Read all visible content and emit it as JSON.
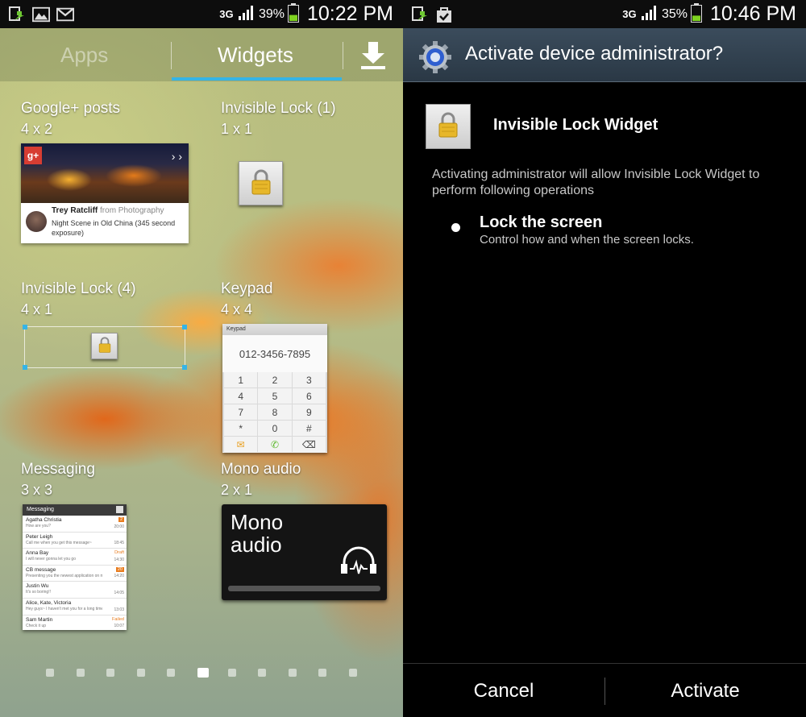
{
  "left": {
    "status": {
      "network": "3G",
      "battery_pct": "39%",
      "battery_level": 0.39,
      "time": "10:22 PM",
      "icons": [
        "screen-mirror-icon",
        "gallery-icon",
        "gmail-icon"
      ]
    },
    "tabs": {
      "apps": "Apps",
      "widgets": "Widgets",
      "download_icon": "download-icon"
    },
    "widgets": {
      "gplus": {
        "title": "Google+ posts",
        "size": "4 x 2",
        "logo": "g+",
        "nav": "› ›",
        "author": "Trey Ratcliff",
        "from": "from Photography",
        "caption": "Night Scene in Old China  (345 second exposure)"
      },
      "lock1": {
        "title": "Invisible Lock (1)",
        "size": "1 x 1"
      },
      "lock4": {
        "title": "Invisible Lock (4)",
        "size": "4 x 1"
      },
      "keypad": {
        "title": "Keypad",
        "size": "4 x 4",
        "header": "Keypad",
        "number": "012-3456-7895",
        "keys": [
          "1",
          "2",
          "3",
          "4",
          "5",
          "6",
          "7",
          "8",
          "9",
          "*",
          "0",
          "#",
          "✉",
          "✆",
          "⌫"
        ]
      },
      "messaging": {
        "title": "Messaging",
        "size": "3 x 3",
        "header": "Messaging",
        "items": [
          {
            "name": "Agatha Christia",
            "preview": "How are you?",
            "time": "20:00",
            "badge": "2",
            "status": ""
          },
          {
            "name": "Peter Leigh",
            "preview": "Call me when you get this message~",
            "time": "18:45",
            "badge": "",
            "status": ""
          },
          {
            "name": "Anna Bay",
            "preview": "I will never gonna let you go",
            "time": "14:30",
            "badge": "",
            "status": "Draft"
          },
          {
            "name": "CB message",
            "preview": "Presenting you the newest application on m...",
            "time": "14:20",
            "badge": "20",
            "status": ""
          },
          {
            "name": "Justin Wu",
            "preview": "It's so boring!!",
            "time": "14:05",
            "badge": "",
            "status": ""
          },
          {
            "name": "Alice, Kate, Victoria",
            "preview": "Hey guys~ I haven't met you for a long time",
            "time": "13:03",
            "badge": "",
            "status": ""
          },
          {
            "name": "Sam Martin",
            "preview": "Check it up",
            "time": "10:07",
            "badge": "",
            "status": "Failed"
          }
        ]
      },
      "mono": {
        "title": "Mono audio",
        "size": "2 x 1",
        "label": "Mono audio"
      }
    },
    "pages": {
      "count": 11,
      "active": 5
    }
  },
  "right": {
    "status": {
      "network": "3G",
      "battery_pct": "35%",
      "battery_level": 0.35,
      "time": "10:46 PM",
      "icons": [
        "screen-mirror-icon",
        "shopping-bag-check-icon"
      ]
    },
    "title": "Activate device administrator?",
    "app_name": "Invisible Lock Widget",
    "description": "Activating administrator will allow Invisible Lock Widget to perform following operations",
    "permission": {
      "title": "Lock the screen",
      "description": "Control how and when the screen locks."
    },
    "buttons": {
      "cancel": "Cancel",
      "activate": "Activate"
    }
  },
  "colors": {
    "accent": "#35b4e6",
    "battery_green": "#7fd320",
    "orange": "#e87c1e"
  }
}
